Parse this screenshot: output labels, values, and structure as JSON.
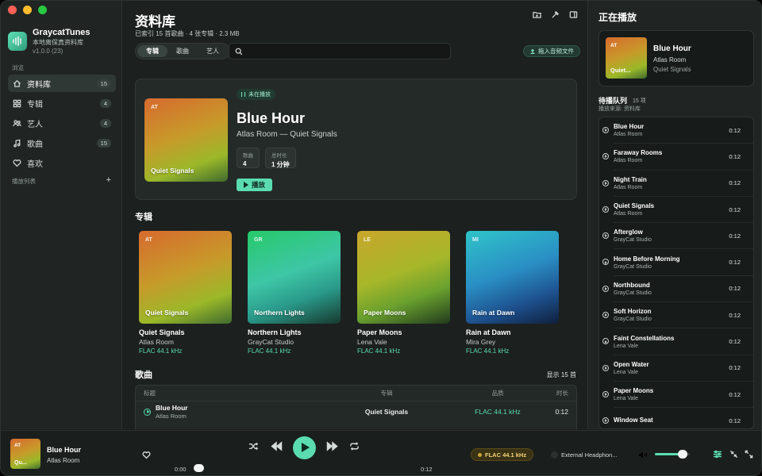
{
  "app": {
    "name": "GraycatTunes",
    "subtitle": "本地离保真资料库",
    "version": "v1.0.0 (23)"
  },
  "sidebar": {
    "browse_label": "浏览",
    "items": [
      {
        "label": "资料库",
        "count": "15",
        "icon": "home-icon"
      },
      {
        "label": "专辑",
        "count": "4",
        "icon": "grid-icon"
      },
      {
        "label": "艺人",
        "count": "4",
        "icon": "people-icon"
      },
      {
        "label": "歌曲",
        "count": "15",
        "icon": "music-note-icon"
      },
      {
        "label": "喜欢",
        "count": "",
        "icon": "heart-icon"
      }
    ],
    "playlists_label": "播放列表",
    "add_label": "+"
  },
  "main": {
    "title": "资料库",
    "subtitle": "已索引 15 首歌曲 · 4 张专辑 · 2.3 MB",
    "tabs": [
      "专辑",
      "歌曲",
      "艺人"
    ],
    "search_placeholder": "",
    "drop_button": "拖入音频文件",
    "hero": {
      "status": "未在播放",
      "title": "Blue Hour",
      "subtitle": "Atlas Room — Quiet Signals",
      "art_code": "AT",
      "art_name": "Quiet Signals",
      "stats": [
        {
          "label": "歌曲",
          "value": "4"
        },
        {
          "label": "总时长",
          "value": "1 分钟"
        }
      ],
      "play_label": "播放"
    },
    "albums_heading": "专辑",
    "albums": [
      {
        "code": "AT",
        "title": "Quiet Signals",
        "artist": "Atlas Room",
        "quality": "FLAC 44.1 kHz"
      },
      {
        "code": "GR",
        "title": "Northern Lights",
        "artist": "GrayCat Studio",
        "quality": "FLAC 44.1 kHz"
      },
      {
        "code": "LE",
        "title": "Paper Moons",
        "artist": "Lena Vale",
        "quality": "FLAC 44.1 kHz"
      },
      {
        "code": "MI",
        "title": "Rain at Dawn",
        "artist": "Mira Grey",
        "quality": "FLAC 44.1 kHz"
      }
    ],
    "songs_heading": "歌曲",
    "songs_count": "显示 15 首",
    "table": {
      "headers": {
        "title": "标题",
        "album": "专辑",
        "quality": "品质",
        "duration": "时长"
      },
      "rows": [
        {
          "title": "Blue Hour",
          "artist": "Atlas Room",
          "album": "Quiet Signals",
          "quality": "FLAC 44.1 kHz",
          "duration": "0:12"
        }
      ]
    }
  },
  "now_playing": {
    "heading": "正在播放",
    "code": "AT",
    "art_name": "Quiet...",
    "title": "Blue Hour",
    "artist": "Atlas Room",
    "album": "Quiet Signals"
  },
  "queue": {
    "heading": "待播队列",
    "count": "15 项",
    "source": "播放来源: 资料库",
    "items": [
      {
        "title": "Blue Hour",
        "artist": "Atlas Room",
        "duration": "0:12"
      },
      {
        "title": "Faraway Rooms",
        "artist": "Atlas Room",
        "duration": "0:12"
      },
      {
        "title": "Night Train",
        "artist": "Atlas Room",
        "duration": "0:12"
      },
      {
        "title": "Quiet Signals",
        "artist": "Atlas Room",
        "duration": "0:12"
      },
      {
        "title": "Afterglow",
        "artist": "GrayCat Studio",
        "duration": "0:12"
      },
      {
        "title": "Home Before Morning",
        "artist": "GrayCat Studio",
        "duration": "0:12"
      },
      {
        "title": "Northbound",
        "artist": "GrayCat Studio",
        "duration": "0:12"
      },
      {
        "title": "Soft Horizon",
        "artist": "GrayCat Studio",
        "duration": "0:12"
      },
      {
        "title": "Faint Constellations",
        "artist": "Lena Vale",
        "duration": "0:12"
      },
      {
        "title": "Open Water",
        "artist": "Lena Vale",
        "duration": "0:12"
      },
      {
        "title": "Paper Moons",
        "artist": "Lena Vale",
        "duration": "0:12"
      },
      {
        "title": "Window Seat",
        "artist": "",
        "duration": "0:12"
      }
    ]
  },
  "player": {
    "code": "AT",
    "art_name": "Qu...",
    "title": "Blue Hour",
    "artist": "Atlas Room",
    "elapsed": "0:00",
    "duration": "0:12",
    "format": "FLAC 44.1 kHz",
    "output_device": "External Headphon...",
    "volume": 0.8
  },
  "colors": {
    "accent": "#5bdcb0",
    "format_badge": "#f3d27b"
  }
}
